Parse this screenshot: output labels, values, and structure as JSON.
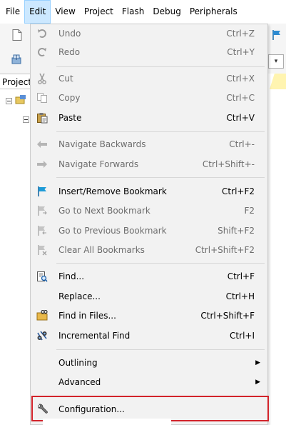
{
  "menubar": {
    "items": [
      "File",
      "Edit",
      "View",
      "Project",
      "Flash",
      "Debug",
      "Peripherals"
    ],
    "active": "Edit"
  },
  "sidebar": {
    "tab_label": "Project"
  },
  "edit_menu": {
    "undo": {
      "label": "Undo",
      "shortcut": "Ctrl+Z",
      "icon": "undo-icon"
    },
    "redo": {
      "label": "Redo",
      "shortcut": "Ctrl+Y",
      "icon": "redo-icon"
    },
    "cut": {
      "label": "Cut",
      "shortcut": "Ctrl+X",
      "icon": "scissors-icon"
    },
    "copy": {
      "label": "Copy",
      "shortcut": "Ctrl+C",
      "icon": "copy-icon"
    },
    "paste": {
      "label": "Paste",
      "shortcut": "Ctrl+V",
      "icon": "clipboard-icon"
    },
    "nav_back": {
      "label": "Navigate Backwards",
      "shortcut": "Ctrl+-",
      "icon": "arrow-left-icon"
    },
    "nav_fwd": {
      "label": "Navigate Forwards",
      "shortcut": "Ctrl+Shift+-",
      "icon": "arrow-right-icon"
    },
    "bm_toggle": {
      "label": "Insert/Remove Bookmark",
      "shortcut": "Ctrl+F2",
      "icon": "bookmark-flag-icon"
    },
    "bm_next": {
      "label": "Go to Next Bookmark",
      "shortcut": "F2",
      "icon": "bookmark-next-icon"
    },
    "bm_prev": {
      "label": "Go to Previous Bookmark",
      "shortcut": "Shift+F2",
      "icon": "bookmark-prev-icon"
    },
    "bm_clear": {
      "label": "Clear All Bookmarks",
      "shortcut": "Ctrl+Shift+F2",
      "icon": "bookmark-clear-icon"
    },
    "find": {
      "label": "Find...",
      "shortcut": "Ctrl+F",
      "icon": "find-icon"
    },
    "replace": {
      "label": "Replace...",
      "shortcut": "Ctrl+H"
    },
    "find_files": {
      "label": "Find in Files...",
      "shortcut": "Ctrl+Shift+F",
      "icon": "find-in-files-icon"
    },
    "inc_find": {
      "label": "Incremental Find",
      "shortcut": "Ctrl+I",
      "icon": "binoculars-icon"
    },
    "outlining": {
      "label": "Outlining",
      "submenu_indicator": "▶"
    },
    "advanced": {
      "label": "Advanced",
      "submenu_indicator": "▶"
    },
    "config": {
      "label": "Configuration...",
      "icon": "wrench-icon"
    }
  },
  "colors": {
    "menu_active_bg": "#cce8ff",
    "menu_active_border": "#99d1ff",
    "disabled_text": "#6d6d6d",
    "highlight_box": "#d2232a"
  }
}
